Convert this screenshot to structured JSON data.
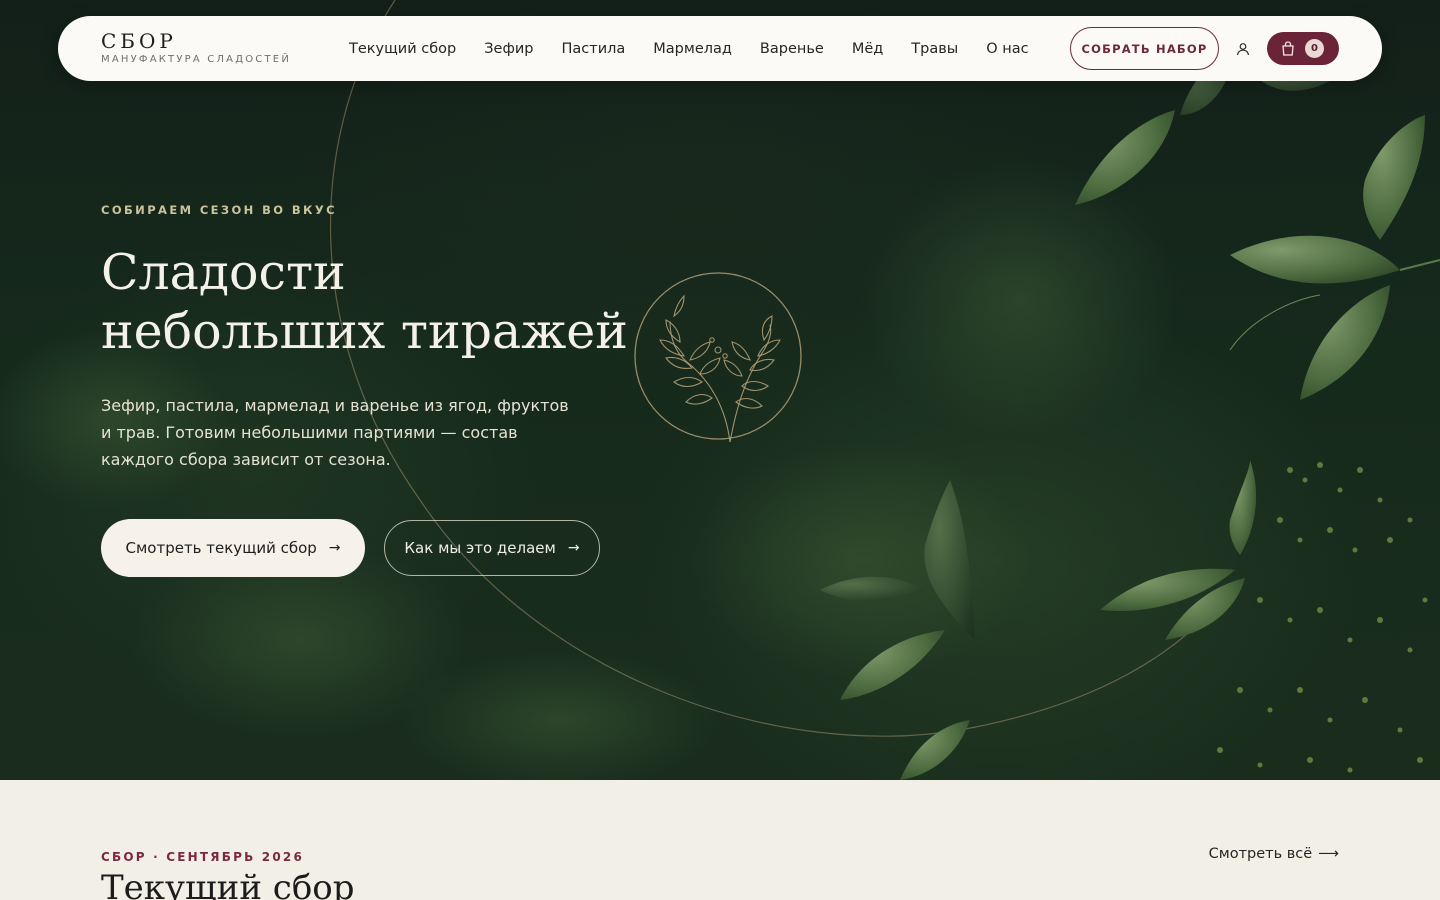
{
  "colors": {
    "accent": "#6b2339",
    "hero_bg": "#162a1c",
    "cream": "#f6f2e9",
    "section_bg": "#f1efe6",
    "gold_line": "#b9a57a"
  },
  "header": {
    "logo_title": "СБОР",
    "logo_subtitle": "МАНУФАКТУРА СЛАДОСТЕЙ",
    "nav": [
      "Текущий сбор",
      "Зефир",
      "Пастила",
      "Мармелад",
      "Варенье",
      "Мёд",
      "Травы",
      "О нас"
    ],
    "cta_label": "СОБРАТЬ НАБОР",
    "user_icon": "user-icon",
    "cart_icon": "shopping-bag-icon",
    "cart_count": "0"
  },
  "hero": {
    "eyebrow": "СОБИРАЕМ СЕЗОН ВО ВКУС",
    "title_line1": "Сладости",
    "title_line2": "небольших тиражей",
    "description": "Зефир, пастила, мармелад и варенье из ягод, фруктов и трав. Готовим небольшими партиями — состав каждого сбора зависит от сезона.",
    "primary_button": "Смотреть текущий сбор",
    "secondary_button": "Как мы это делаем",
    "arrow_glyph": "→",
    "emblem_icon": "botanical-emblem-icon"
  },
  "section": {
    "eyebrow": "СБОР · СЕНТЯБРЬ 2026",
    "title": "Текущий сбор",
    "see_all": "Смотреть всё",
    "see_all_arrow": "⟶"
  }
}
